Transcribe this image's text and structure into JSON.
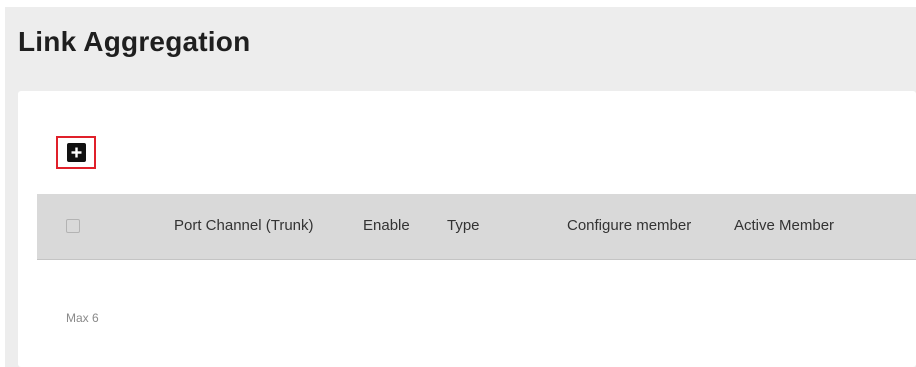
{
  "page": {
    "title": "Link Aggregation"
  },
  "toolbar": {
    "add_icon": "plus-square-icon",
    "highlight_color": "#e0202a"
  },
  "table": {
    "columns": [
      "Port Channel (Trunk)",
      "Enable",
      "Type",
      "Configure member",
      "Active Member"
    ],
    "rows": []
  },
  "footer": {
    "max_note": "Max 6"
  },
  "colors": {
    "background": "#ededed",
    "card": "#ffffff",
    "header_bg": "#d9d9d9",
    "title_text": "#1f1f1f"
  }
}
